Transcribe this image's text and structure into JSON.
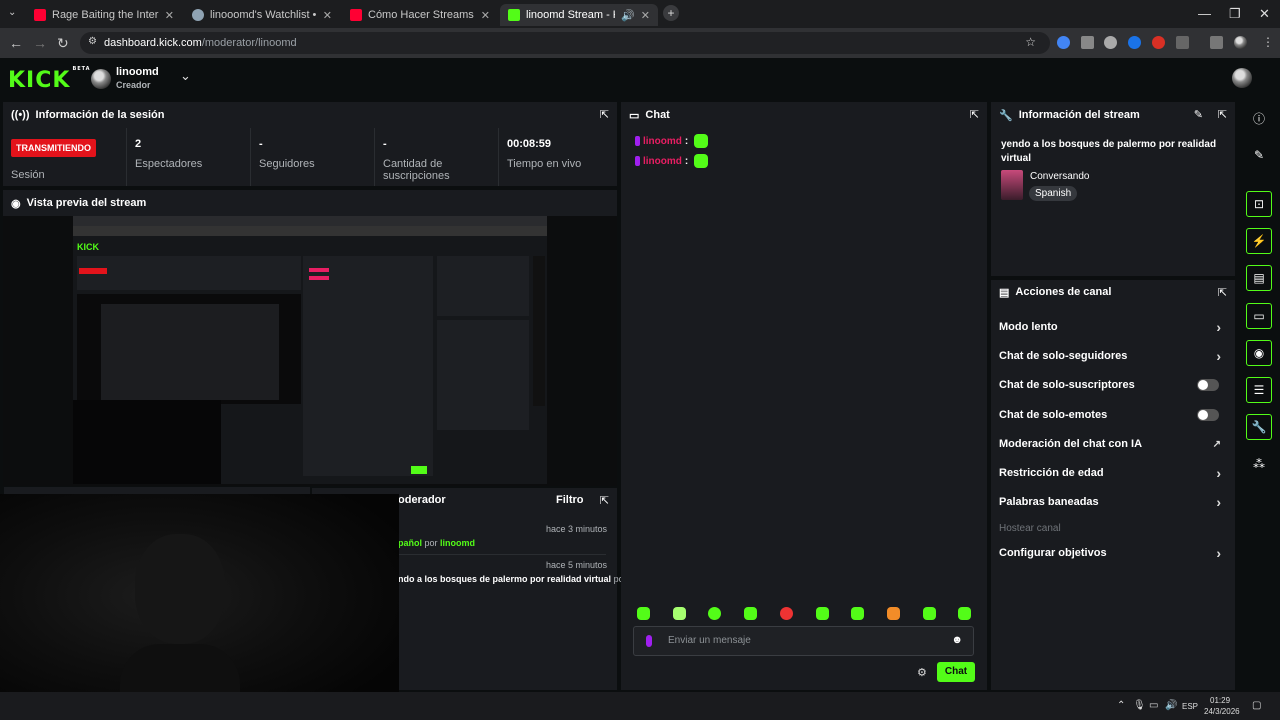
{
  "browser": {
    "tabs": [
      {
        "title": "Rage Baiting the Internet's Mo",
        "favicon_color": "#ff0033"
      },
      {
        "title": "linooomd's Watchlist • Letterb",
        "favicon_color": "#8fa3b3"
      },
      {
        "title": "Cómo Hacer Streams en Kick (C",
        "favicon_color": "#ff0033"
      },
      {
        "title": "linoomd Stream - Kick Dash",
        "favicon_color": "#53fc18",
        "active": true
      }
    ],
    "url_host": "dashboard.kick.com",
    "url_path": "/moderator/linoomd",
    "win_min": "—",
    "win_max": "❐",
    "win_close": "✕"
  },
  "header": {
    "logo": "KICK",
    "logo_badge": "BETA",
    "username": "linoomd",
    "role": "Creador"
  },
  "session": {
    "title": "Información de la sesión",
    "status_badge": "TRANSMITIENDO",
    "status_label": "Sesión",
    "stats": [
      {
        "value": "2",
        "label": "Espectadores"
      },
      {
        "value": "-",
        "label": "Seguidores"
      },
      {
        "value": "-",
        "label": "Cantidad de suscripciones"
      },
      {
        "value": "00:08:59",
        "label": "Tiempo en vivo"
      }
    ]
  },
  "preview": {
    "title": "Vista previa del stream"
  },
  "modlog": {
    "title_partial": "oderador",
    "filter": "Filtro",
    "entries": [
      {
        "time": "hace 3 minutos",
        "text": "pañol",
        "by": "por",
        "user": "linoomd"
      },
      {
        "time": "hace 5 minutos",
        "text": "ndo a los bosques de palermo por realidad virtual",
        "by": "por"
      }
    ]
  },
  "chat": {
    "title": "Chat",
    "messages": [
      {
        "user": "linoomd",
        "sep": ":"
      },
      {
        "user": "linoomd",
        "sep": ":"
      }
    ],
    "input_placeholder": "Enviar un mensaje",
    "send_label": "Chat"
  },
  "stream_info": {
    "title": "Información del stream",
    "stream_title": "yendo a los bosques de palermo por realidad virtual",
    "category": "Conversando",
    "language": "Spanish"
  },
  "channel_actions": {
    "title": "Acciones de canal",
    "items": [
      {
        "label": "Modo lento",
        "control": "chevron"
      },
      {
        "label": "Chat de solo-seguidores",
        "control": "chevron"
      },
      {
        "label": "Chat de solo-suscriptores",
        "control": "toggle",
        "on": false
      },
      {
        "label": "Chat de solo-emotes",
        "control": "toggle",
        "on": false
      },
      {
        "label": "Moderación del chat con IA",
        "control": "external"
      },
      {
        "label": "Restricción de edad",
        "control": "chevron"
      },
      {
        "label": "Palabras baneadas",
        "control": "chevron"
      },
      {
        "label": "Hostear canal",
        "control": "none",
        "disabled": true
      },
      {
        "label": "Configurar objetivos",
        "control": "chevron"
      }
    ]
  },
  "taskbar": {
    "lang": "ESP",
    "time": "01:29",
    "date": "24/3/2026"
  },
  "colors": {
    "accent": "#53fc18",
    "live": "#e3131b",
    "username": "#e91e63"
  }
}
